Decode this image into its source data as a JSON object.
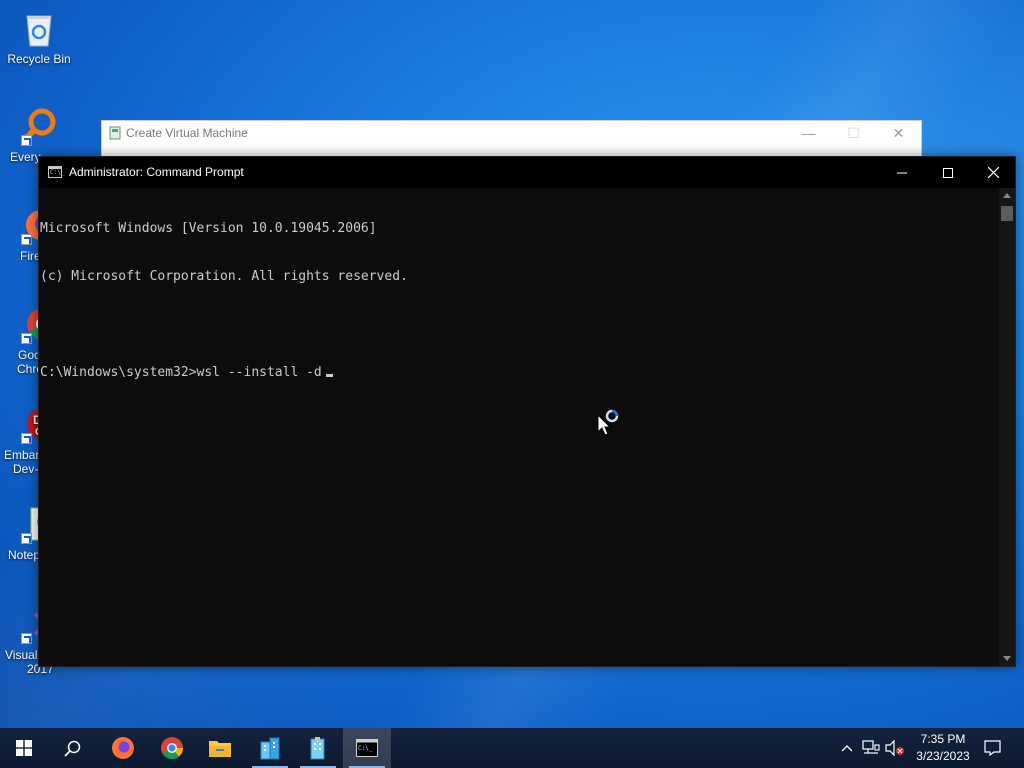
{
  "desktop": {
    "icons": [
      {
        "label": "Recycle Bin",
        "icon": "recycle-bin-icon"
      },
      {
        "label": "Every",
        "icon": "everything-search-icon"
      },
      {
        "label": "Fire",
        "icon": "firefox-icon"
      },
      {
        "label_line1": "Goo",
        "label_line2": "Chro",
        "icon": "chrome-icon"
      },
      {
        "label_line1": "Embar",
        "label_line2": "Dev-",
        "icon": "embarcadero-dev-cpp-icon"
      },
      {
        "label": "Notep",
        "icon": "notepad-plus-plus-icon"
      },
      {
        "label_line1": "Visual",
        "label_line2": "2017",
        "icon": "visual-studio-icon"
      }
    ]
  },
  "background_window": {
    "title": "Create Virtual Machine",
    "minimize": "—",
    "maximize": "☐",
    "close": "✕"
  },
  "cmd_window": {
    "title": "Administrator: Command Prompt",
    "icon_text": "C:\\_",
    "lines": [
      "Microsoft Windows [Version 10.0.19045.2006]",
      "(c) Microsoft Corporation. All rights reserved.",
      "",
      "C:\\Windows\\system32>wsl --install -d"
    ]
  },
  "taskbar": {
    "buttons": [
      {
        "name": "start-button",
        "icon": "windows-logo-icon"
      },
      {
        "name": "search-button",
        "icon": "search-icon"
      },
      {
        "name": "firefox-button",
        "icon": "firefox-icon"
      },
      {
        "name": "chrome-button",
        "icon": "chrome-icon"
      },
      {
        "name": "file-explorer-button",
        "icon": "folder-icon"
      },
      {
        "name": "app-building-1-button",
        "icon": "building-app-icon"
      },
      {
        "name": "app-building-2-button",
        "icon": "building-app-icon"
      },
      {
        "name": "command-prompt-button",
        "icon": "cmd-icon"
      }
    ],
    "clock": {
      "time": "7:35 PM",
      "date": "3/23/2023"
    }
  },
  "colors": {
    "desktop_blue": "#1a7fe0",
    "console_bg": "#0c0c0c",
    "console_text": "#cccccc",
    "taskbar": "#0c1a30"
  }
}
